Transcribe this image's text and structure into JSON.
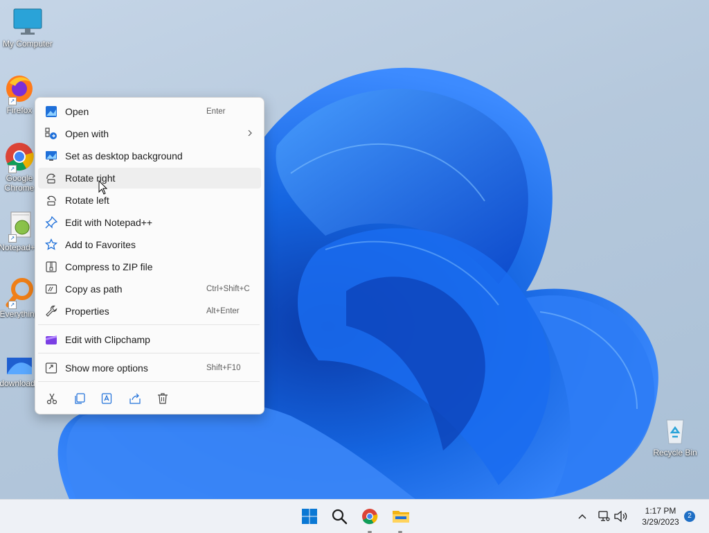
{
  "desktop": {
    "icons": [
      {
        "label": "My Computer"
      },
      {
        "label": "Firefox"
      },
      {
        "label": "Google Chrome"
      },
      {
        "label": "Notepad++"
      },
      {
        "label": "Everything"
      },
      {
        "label": "downloads"
      },
      {
        "label": "Recycle Bin"
      }
    ]
  },
  "context_menu": {
    "items": [
      {
        "label": "Open",
        "shortcut": "Enter",
        "icon": "image-open-icon"
      },
      {
        "label": "Open with",
        "shortcut": "",
        "icon": "open-with-icon",
        "submenu": true
      },
      {
        "label": "Set as desktop background",
        "shortcut": "",
        "icon": "desktop-background-icon"
      },
      {
        "label": "Rotate right",
        "shortcut": "",
        "icon": "rotate-right-icon",
        "hovered": true
      },
      {
        "label": "Rotate left",
        "shortcut": "",
        "icon": "rotate-left-icon"
      },
      {
        "label": "Edit with Notepad++",
        "shortcut": "",
        "icon": "pin-icon"
      },
      {
        "label": "Add to Favorites",
        "shortcut": "",
        "icon": "star-icon"
      },
      {
        "label": "Compress to ZIP file",
        "shortcut": "",
        "icon": "zip-icon"
      },
      {
        "label": "Copy as path",
        "shortcut": "Ctrl+Shift+C",
        "icon": "copy-path-icon"
      },
      {
        "label": "Properties",
        "shortcut": "Alt+Enter",
        "icon": "wrench-icon"
      },
      {
        "label": "Edit with Clipchamp",
        "shortcut": "",
        "icon": "clipchamp-icon"
      },
      {
        "label": "Show more options",
        "shortcut": "Shift+F10",
        "icon": "show-more-icon"
      }
    ],
    "quick_actions": [
      "cut-icon",
      "copy-icon",
      "rename-icon",
      "share-icon",
      "delete-icon"
    ]
  },
  "taskbar": {
    "apps": [
      "start-icon",
      "search-icon",
      "chrome-icon",
      "file-explorer-icon"
    ],
    "clock_time": "1:17 PM",
    "clock_date": "3/29/2023",
    "notification_count": "2"
  },
  "colors": {
    "accent": "#0067c0",
    "menu_bg": "#fbfbfb",
    "taskbar_bg": "#eef1f6"
  }
}
